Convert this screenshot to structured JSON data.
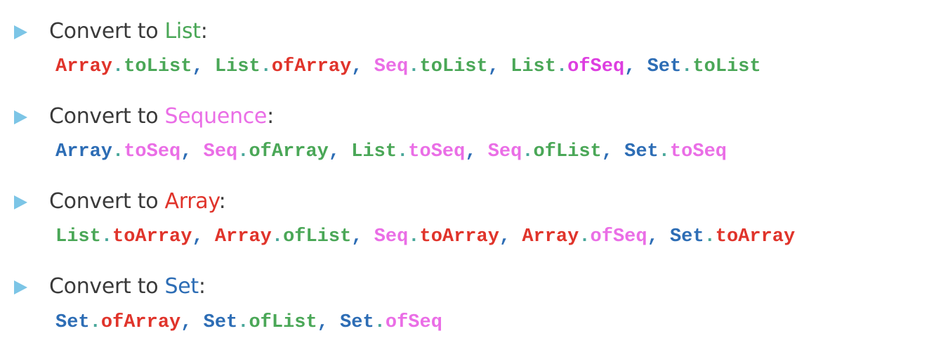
{
  "colors": {
    "text": "#3a3a3a",
    "bullet": "#7cc5e6",
    "separator": "#2d6db5",
    "dot": "#4aa89b",
    "list": "#4aa757",
    "seq": "#ea6ee6",
    "array": "#e0342b",
    "set": "#2d6db5"
  },
  "icons": {
    "bullet": "triangle-right-icon"
  },
  "sections": [
    {
      "prefix": "Convert to ",
      "target": "List",
      "target_color": "#4aa757",
      "suffix": ":",
      "functions": [
        {
          "module": "Array",
          "module_color": "#e0342b",
          "func": "toList",
          "func_color": "#4aa757"
        },
        {
          "module": "List",
          "module_color": "#4aa757",
          "func": "ofArray",
          "func_color": "#e0342b"
        },
        {
          "module": "Seq",
          "module_color": "#ea6ee6",
          "func": "toList",
          "func_color": "#4aa757"
        },
        {
          "module": "List",
          "module_color": "#4aa757",
          "func": "ofSeq",
          "func_color": "#dd3ee0"
        },
        {
          "module": "Set",
          "module_color": "#2d6db5",
          "func": "toList",
          "func_color": "#4aa757"
        }
      ]
    },
    {
      "prefix": "Convert to ",
      "target": "Sequence",
      "target_color": "#ea6ee6",
      "suffix": ":",
      "functions": [
        {
          "module": "Array",
          "module_color": "#2d6db5",
          "func": "toSeq",
          "func_color": "#ea6ee6"
        },
        {
          "module": "Seq",
          "module_color": "#ea6ee6",
          "func": "ofArray",
          "func_color": "#4aa757"
        },
        {
          "module": "List",
          "module_color": "#4aa757",
          "func": "toSeq",
          "func_color": "#ea6ee6"
        },
        {
          "module": "Seq",
          "module_color": "#ea6ee6",
          "func": "ofList",
          "func_color": "#4aa757"
        },
        {
          "module": "Set",
          "module_color": "#2d6db5",
          "func": "toSeq",
          "func_color": "#ea6ee6"
        }
      ]
    },
    {
      "prefix": "Convert to ",
      "target": "Array",
      "target_color": "#e0342b",
      "suffix": ":",
      "functions": [
        {
          "module": "List",
          "module_color": "#4aa757",
          "func": "toArray",
          "func_color": "#e0342b"
        },
        {
          "module": "Array",
          "module_color": "#e0342b",
          "func": "ofList",
          "func_color": "#4aa757"
        },
        {
          "module": "Seq",
          "module_color": "#ea6ee6",
          "func": "toArray",
          "func_color": "#e0342b"
        },
        {
          "module": "Array",
          "module_color": "#e0342b",
          "func": "ofSeq",
          "func_color": "#ea6ee6"
        },
        {
          "module": "Set",
          "module_color": "#2d6db5",
          "func": "toArray",
          "func_color": "#e0342b"
        }
      ]
    },
    {
      "prefix": "Convert to ",
      "target": "Set",
      "target_color": "#2d6db5",
      "suffix": ":",
      "functions": [
        {
          "module": "Set",
          "module_color": "#2d6db5",
          "func": "ofArray",
          "func_color": "#e0342b"
        },
        {
          "module": "Set",
          "module_color": "#2d6db5",
          "func": "ofList",
          "func_color": "#4aa757"
        },
        {
          "module": "Set",
          "module_color": "#2d6db5",
          "func": "ofSeq",
          "func_color": "#ea6ee6"
        }
      ]
    }
  ]
}
